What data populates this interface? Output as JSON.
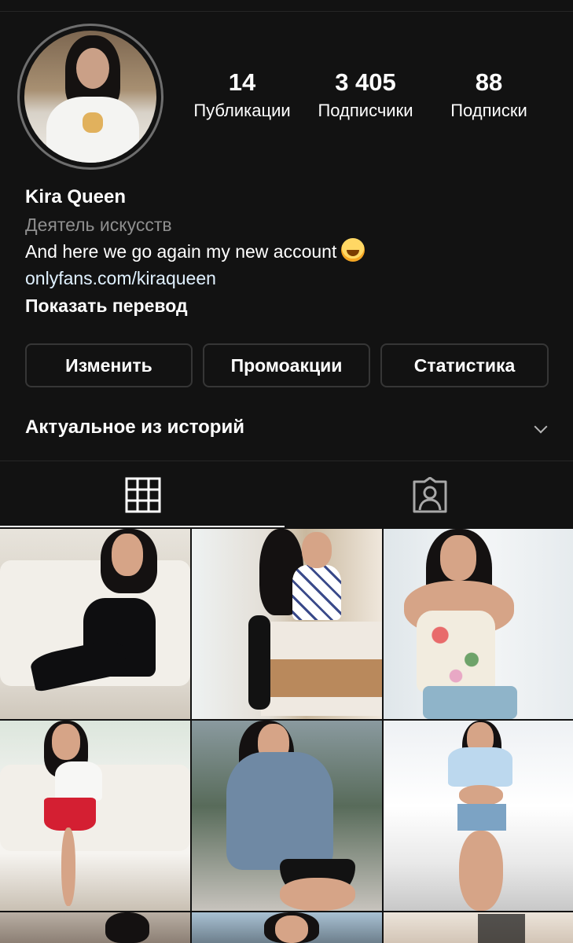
{
  "profile": {
    "avatar_alt": "profile-photo",
    "stats": {
      "posts_count": "14",
      "posts_label": "Публикации",
      "followers_count": "3 405",
      "followers_label": "Подписчики",
      "following_count": "88",
      "following_label": "Подписки"
    },
    "name": "Kira Queen",
    "category": "Деятель искусств",
    "bio_text": "And here we go again my new account",
    "bio_emoji": "face-with-tears-of-joy",
    "link": "onlyfans.com/kiraqueen",
    "translate_label": "Показать перевод"
  },
  "actions": {
    "edit_label": "Изменить",
    "promo_label": "Промоакции",
    "stats_label": "Статистика"
  },
  "highlights": {
    "title": "Актуальное из историй"
  },
  "tabs": [
    {
      "name": "posts-grid",
      "icon": "grid-icon",
      "active": true
    },
    {
      "name": "tagged",
      "icon": "person-tag-icon",
      "active": false
    }
  ],
  "colors": {
    "background": "#121212",
    "divider": "#262626",
    "secondary_text": "#8e8e8e",
    "button_border": "#363636",
    "text": "#ffffff"
  },
  "grid": {
    "photos": [
      "photo-1",
      "photo-2",
      "photo-3",
      "photo-4",
      "photo-5",
      "photo-6",
      "photo-7",
      "photo-8",
      "photo-9"
    ]
  }
}
